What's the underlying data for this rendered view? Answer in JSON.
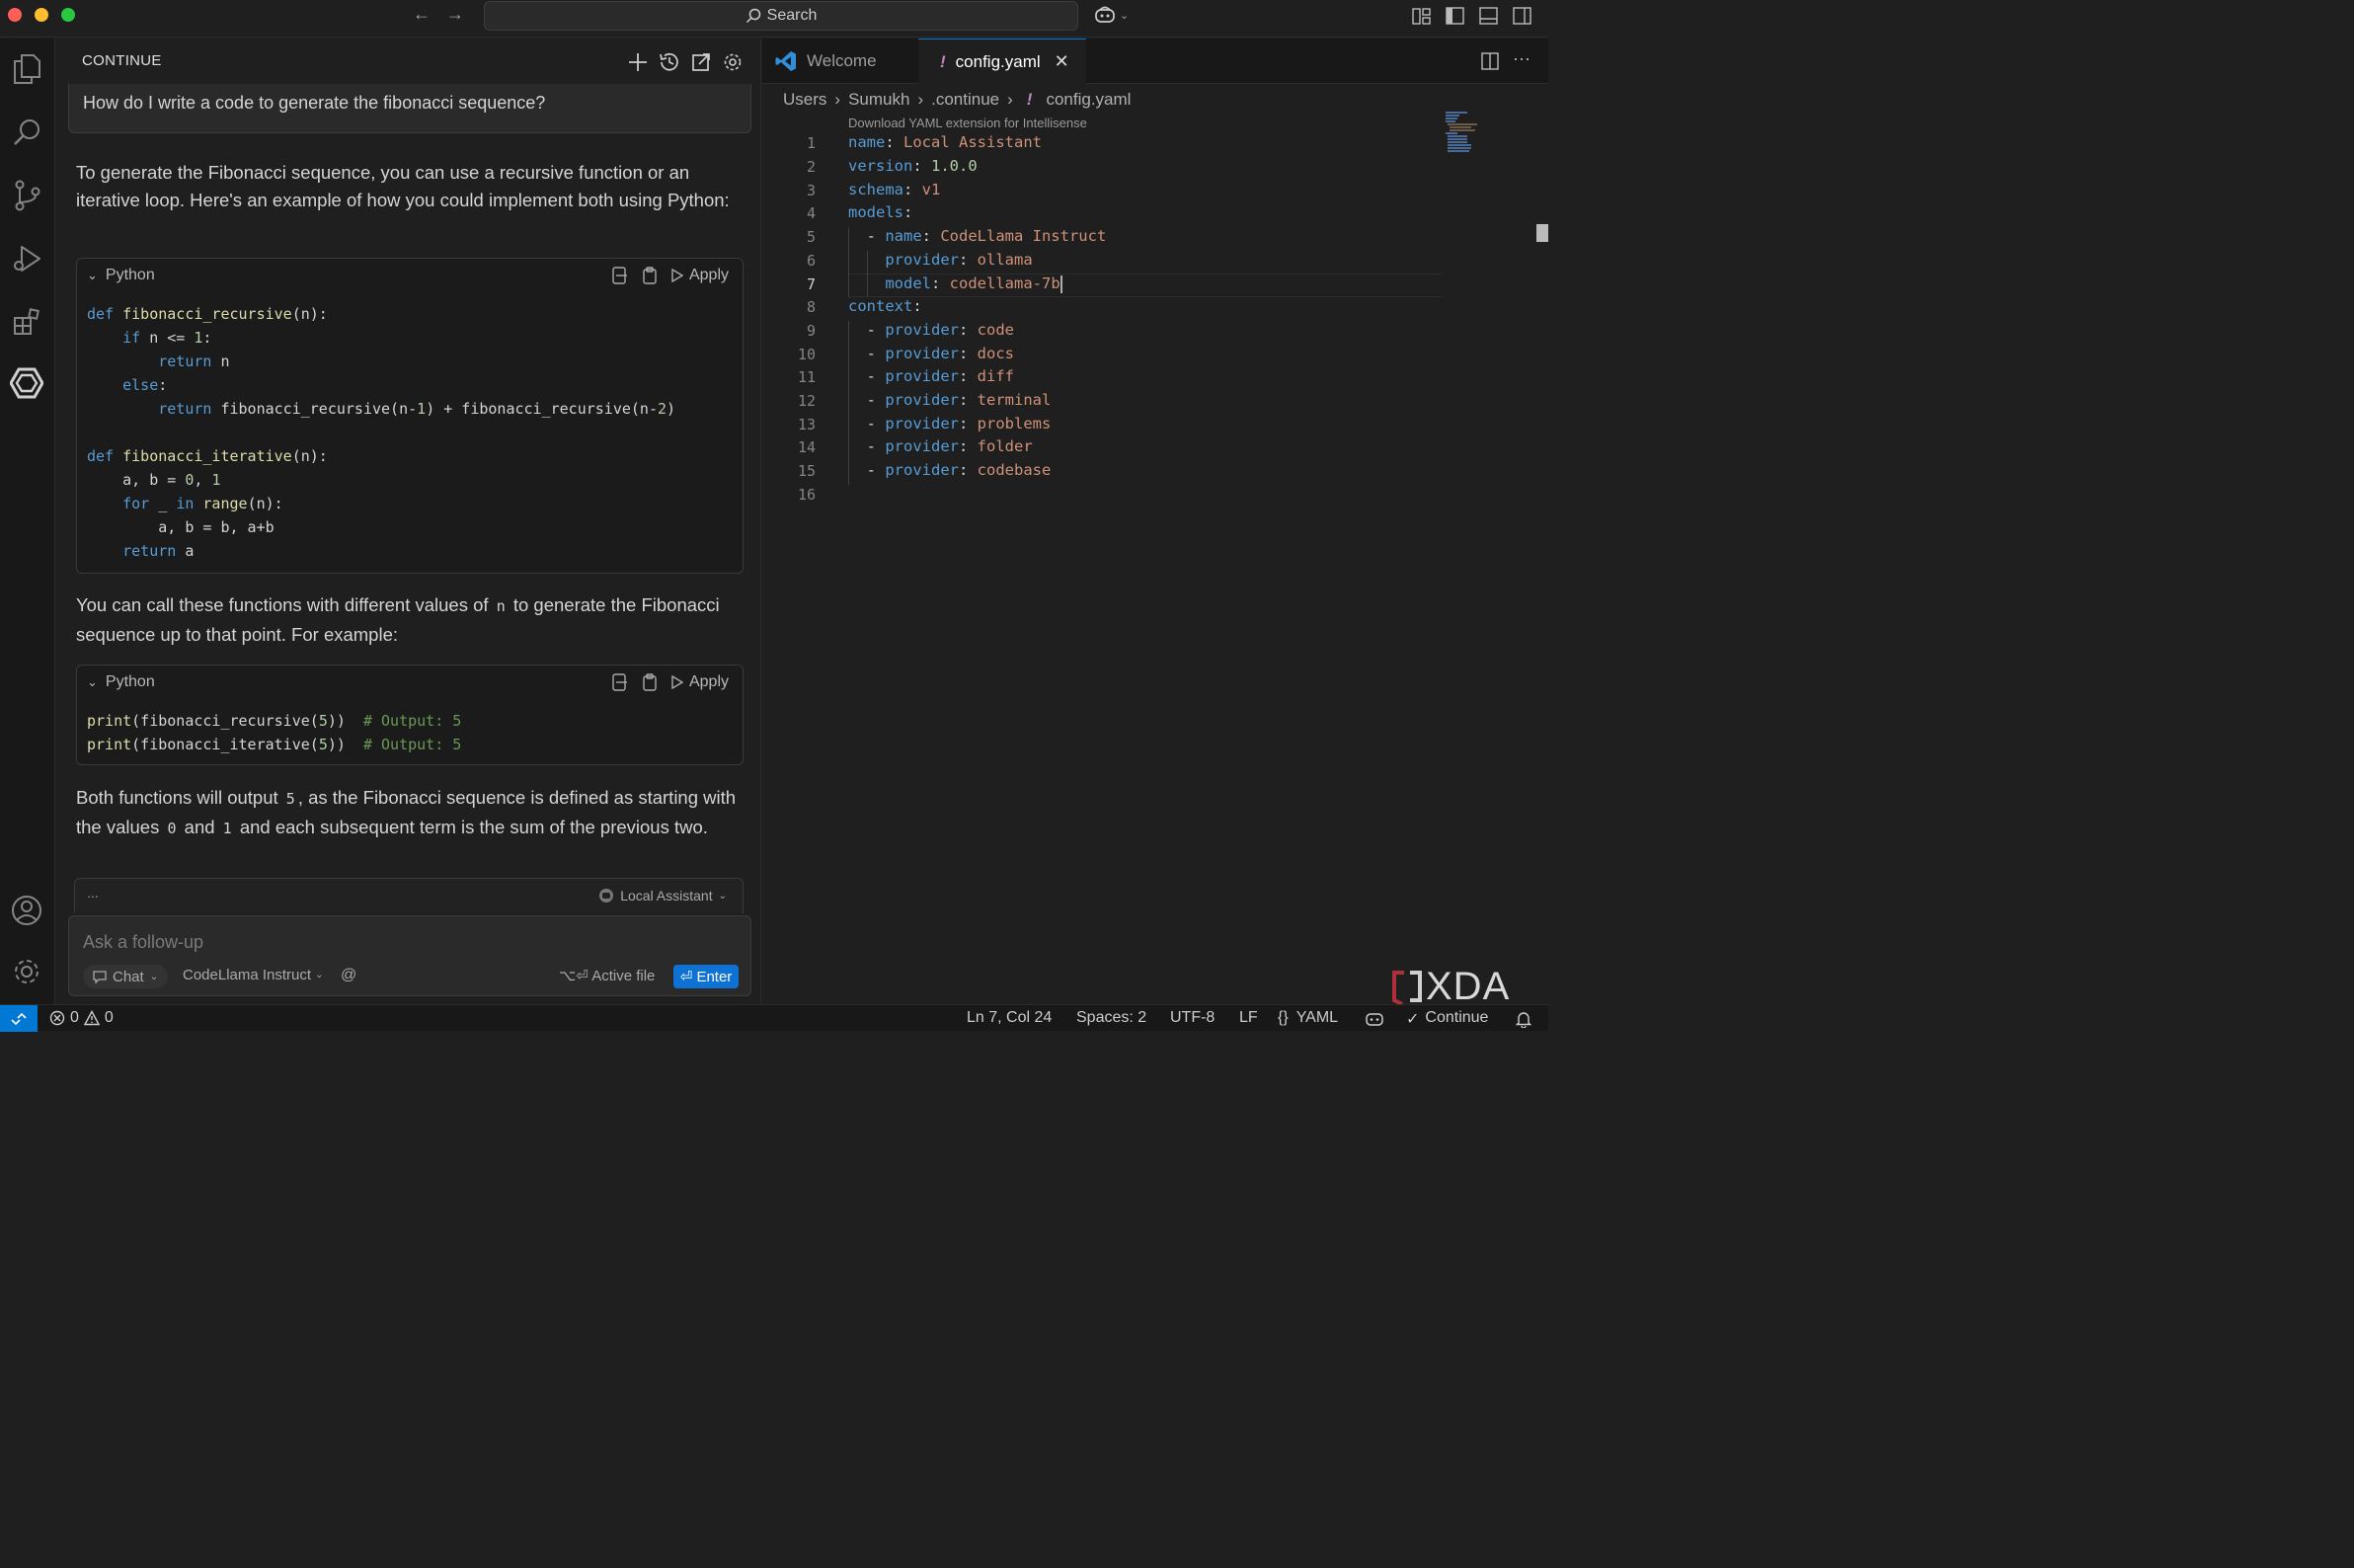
{
  "titlebar": {
    "search": "Search"
  },
  "chat": {
    "header": "CONTINUE",
    "user_message": "How do I write a code to generate the fibonacci sequence?",
    "para1": "To generate the Fibonacci sequence, you can use a recursive function or an iterative loop. Here's an example of how you could implement both using Python:",
    "block1": {
      "lang": "Python",
      "apply": "Apply"
    },
    "para2_a": "You can call these functions with different values of ",
    "para2_code": "n",
    "para2_b": " to generate the Fibonacci sequence up to that point. For example:",
    "block2": {
      "lang": "Python",
      "apply": "Apply"
    },
    "para3_a": "Both functions will output ",
    "para3_code1": "5",
    "para3_b": ", as the Fibonacci sequence is defined as starting with the values ",
    "para3_code2": "0",
    "para3_c": " and ",
    "para3_code3": "1",
    "para3_d": " and each subsequent term is the sum of the previous two.",
    "strip_dots": "...",
    "strip_model": "Local Assistant",
    "input_placeholder": "Ask a follow-up",
    "mode": "Chat",
    "model": "CodeLlama Instruct",
    "at": "@",
    "active_file": "⌥⏎ Active file",
    "enter": "⏎ Enter"
  },
  "editor": {
    "tabs": [
      {
        "label": "Welcome"
      },
      {
        "label": "config.yaml",
        "marker": "!"
      }
    ],
    "breadcrumb": [
      "Users",
      "Sumukh",
      ".continue",
      "config.yaml"
    ],
    "hint": "Download YAML extension for Intellisense",
    "line_numbers": [
      "1",
      "2",
      "3",
      "4",
      "5",
      "6",
      "7",
      "8",
      "9",
      "10",
      "11",
      "12",
      "13",
      "14",
      "15",
      "16"
    ],
    "yaml": {
      "l1k": "name",
      "l1v": "Local Assistant",
      "l2k": "version",
      "l2v": "1.0.0",
      "l3k": "schema",
      "l3v": "v1",
      "l4k": "models",
      "l5k": "name",
      "l5v": "CodeLlama Instruct",
      "l6k": "provider",
      "l6v": "ollama",
      "l7k": "model",
      "l7v": "codellama-7b",
      "l8k": "context",
      "providers": [
        "code",
        "docs",
        "diff",
        "terminal",
        "problems",
        "folder",
        "codebase"
      ],
      "provider_key": "provider"
    }
  },
  "statusbar": {
    "errors": "0",
    "warnings": "0",
    "position": "Ln 7, Col 24",
    "spaces": "Spaces: 2",
    "encoding": "UTF-8",
    "eol": "LF",
    "language": "YAML",
    "continue": "Continue"
  },
  "watermark": "XDA"
}
